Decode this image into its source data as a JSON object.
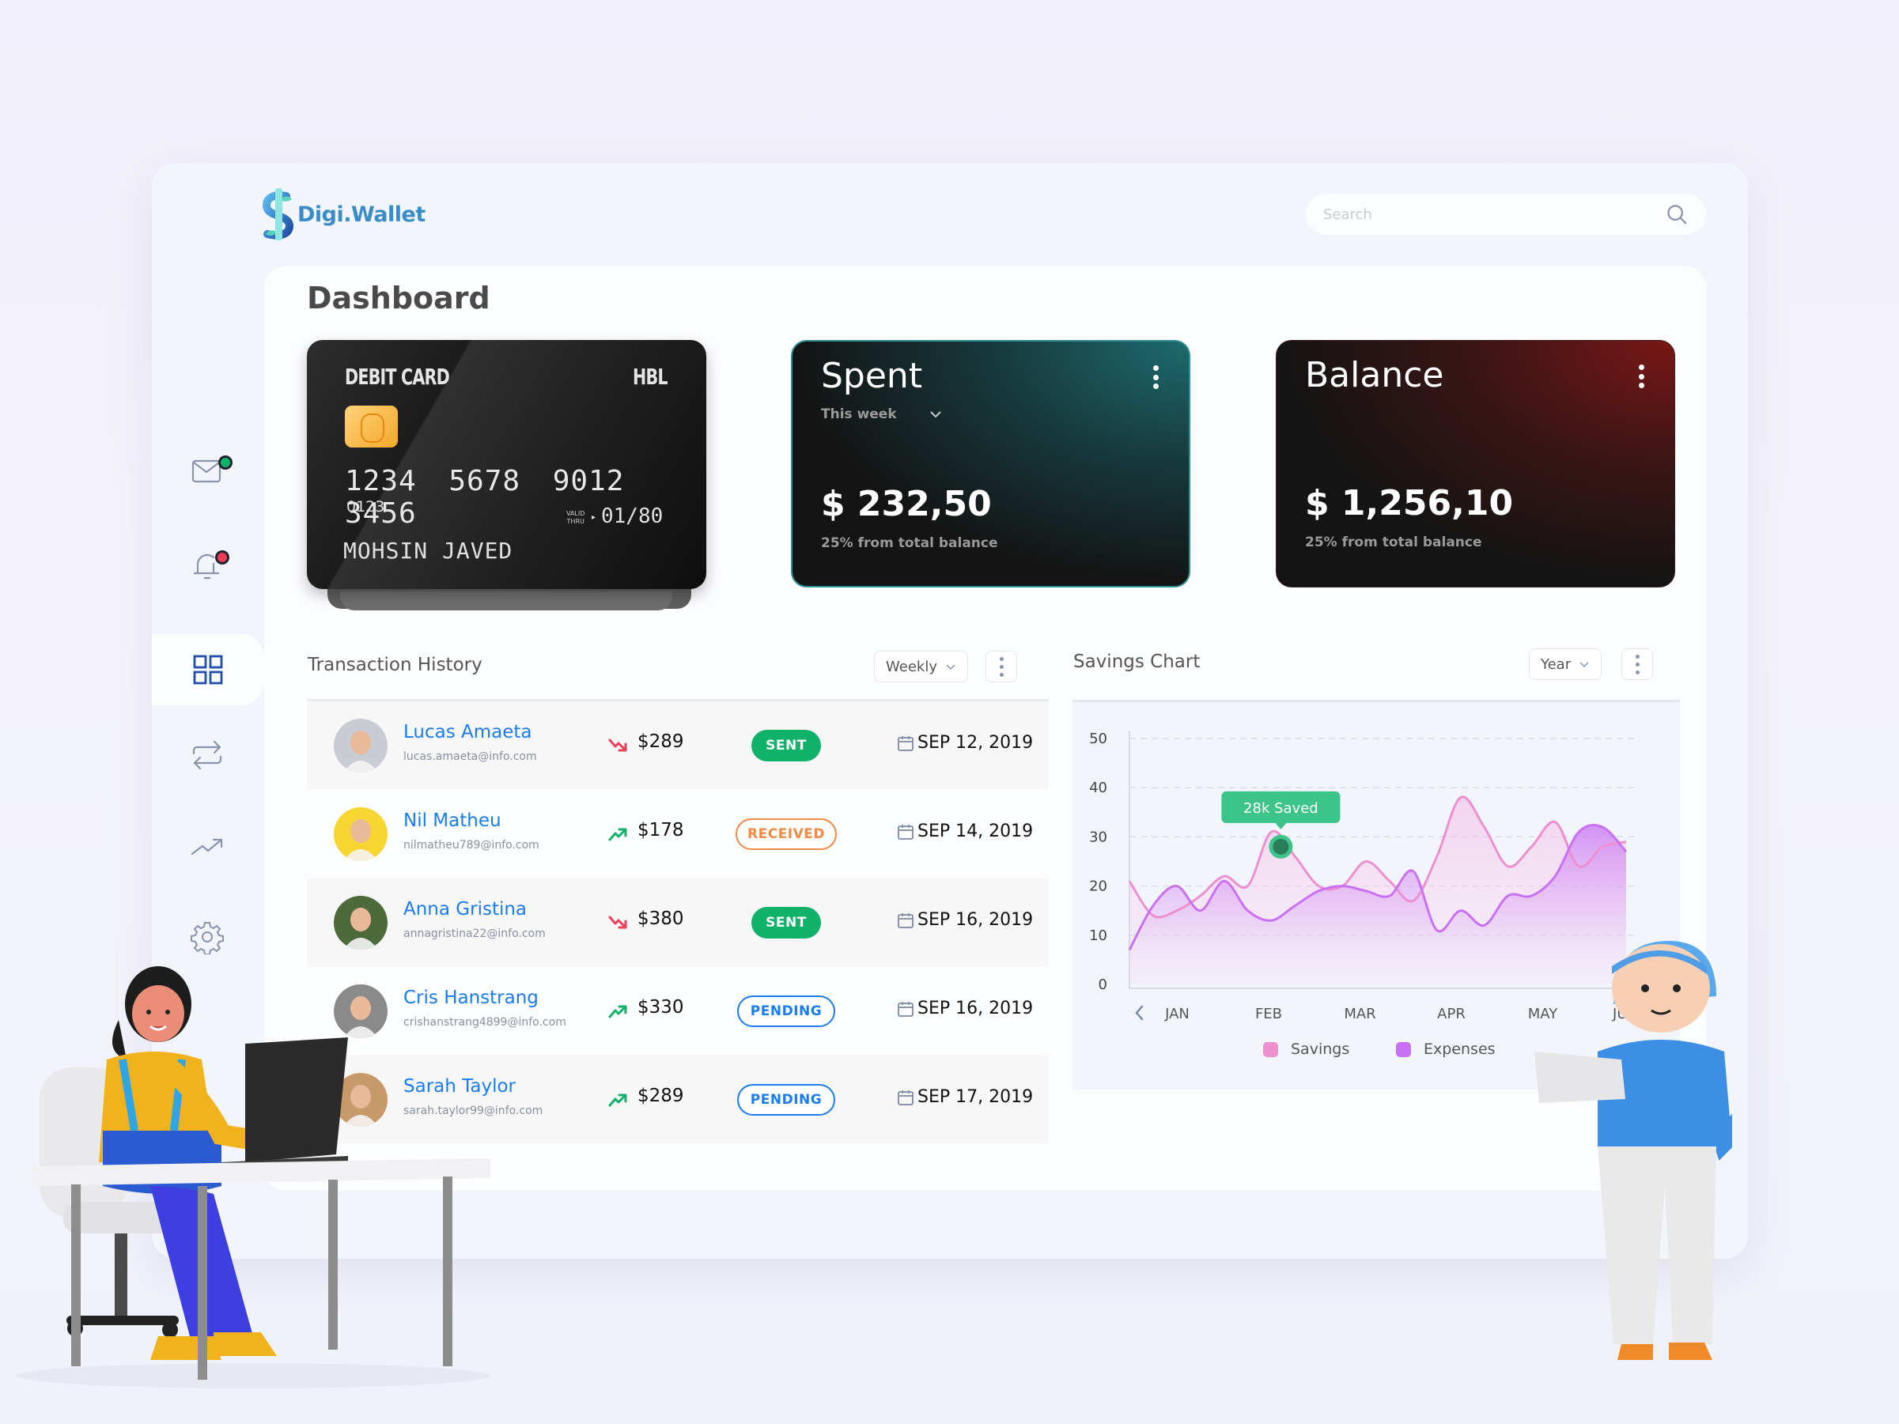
{
  "app": {
    "name": "Digi.Wallet",
    "logo_icon": "dollar-sign-logo-icon"
  },
  "search": {
    "placeholder": "Search",
    "value": "",
    "icon": "search-icon"
  },
  "sidebar": {
    "items": [
      {
        "id": "messages",
        "icon": "mail-icon",
        "badge_color": "#0fb56b",
        "active": false
      },
      {
        "id": "notifications",
        "icon": "bell-icon",
        "badge_color": "#f03e56",
        "active": false
      },
      {
        "id": "dashboard",
        "icon": "grid-icon",
        "active": true
      },
      {
        "id": "transfers",
        "icon": "transfer-arrows-icon",
        "active": false
      },
      {
        "id": "analytics",
        "icon": "trending-up-icon",
        "active": false
      },
      {
        "id": "settings",
        "icon": "gear-icon",
        "active": false
      }
    ]
  },
  "page": {
    "title": "Dashboard"
  },
  "debit_card": {
    "type_label": "DEBIT CARD",
    "bank": "HBL",
    "number": "1234 5678 9012 3456",
    "sub_number": "0123",
    "valid_label_line1": "VALID",
    "valid_label_line2": "THRU",
    "expiry": "01/80",
    "holder": "MOHSIN JAVED"
  },
  "spent_card": {
    "title": "Spent",
    "period": "This week",
    "amount": "$ 232,50",
    "note": "25% from total balance",
    "accent": "#2e8f96"
  },
  "balance_card": {
    "title": "Balance",
    "amount": "$ 1,256,10",
    "note": "25% from total balance",
    "accent": "#7a1616"
  },
  "transactions": {
    "title": "Transaction History",
    "filter": "Weekly",
    "rows": [
      {
        "name": "Lucas Amaeta",
        "email": "lucas.amaeta@info.com",
        "trend": "down",
        "amount": "$289",
        "status": "SENT",
        "status_kind": "sent",
        "date": "SEP 12, 2019",
        "avatar_bg": "#c9ccd3"
      },
      {
        "name": "Nil Matheu",
        "email": "nilmatheu789@info.com",
        "trend": "up",
        "amount": "$178",
        "status": "RECEIVED",
        "status_kind": "received",
        "date": "SEP 14, 2019",
        "avatar_bg": "#f7d631"
      },
      {
        "name": "Anna Gristina",
        "email": "annagristina22@info.com",
        "trend": "down",
        "amount": "$380",
        "status": "SENT",
        "status_kind": "sent",
        "date": "SEP 16, 2019",
        "avatar_bg": "#4d6b3a"
      },
      {
        "name": "Cris Hanstrang",
        "email": "crishanstrang4899@info.com",
        "trend": "up",
        "amount": "$330",
        "status": "PENDING",
        "status_kind": "pending",
        "date": "SEP 16, 2019",
        "avatar_bg": "#8a8a8a"
      },
      {
        "name": "Sarah Taylor",
        "email": "sarah.taylor99@info.com",
        "trend": "up",
        "amount": "$289",
        "status": "PENDING",
        "status_kind": "pending",
        "date": "SEP 17, 2019",
        "avatar_bg": "#c89a6a"
      }
    ]
  },
  "savings": {
    "title": "Savings Chart",
    "filter": "Year"
  },
  "chart_data": {
    "type": "area",
    "title": "Savings Chart",
    "xlabel": "",
    "ylabel": "",
    "categories": [
      "JAN",
      "FEB",
      "MAR",
      "APR",
      "MAY",
      "JUN"
    ],
    "ylim": [
      0,
      50
    ],
    "yticks": [
      0,
      10,
      20,
      30,
      40,
      50
    ],
    "grid": true,
    "legend_position": "bottom",
    "x": [
      0,
      0.25,
      0.5,
      0.75,
      1.0,
      1.25,
      1.5,
      1.75,
      2.0,
      2.25,
      2.5,
      2.75,
      3.0,
      3.25,
      3.5,
      3.75,
      4.0,
      4.25,
      4.5,
      4.75,
      5.0,
      5.25
    ],
    "series": [
      {
        "name": "Savings",
        "color": "#ee8fd0",
        "values": [
          21,
          14,
          15,
          18,
          22,
          20,
          31,
          26,
          20,
          20,
          25,
          21,
          17,
          26,
          38,
          32,
          24,
          28,
          33,
          24,
          28,
          29
        ]
      },
      {
        "name": "Expenses",
        "color": "#c971f2",
        "values": [
          7,
          16,
          20,
          15,
          21,
          15,
          13,
          16,
          19,
          20,
          19,
          18,
          23,
          11,
          15,
          12,
          18,
          18,
          22,
          31,
          32,
          27
        ]
      }
    ],
    "annotation": {
      "label": "28k Saved",
      "x": 1.6,
      "y": 28,
      "color": "#3cc48a"
    }
  },
  "legend": [
    {
      "label": "Savings",
      "color": "#ee8fd0"
    },
    {
      "label": "Expenses",
      "color": "#c971f2"
    }
  ],
  "illustrations": {
    "left": "woman-at-desk-with-laptop",
    "right": "man-holding-laptop"
  }
}
